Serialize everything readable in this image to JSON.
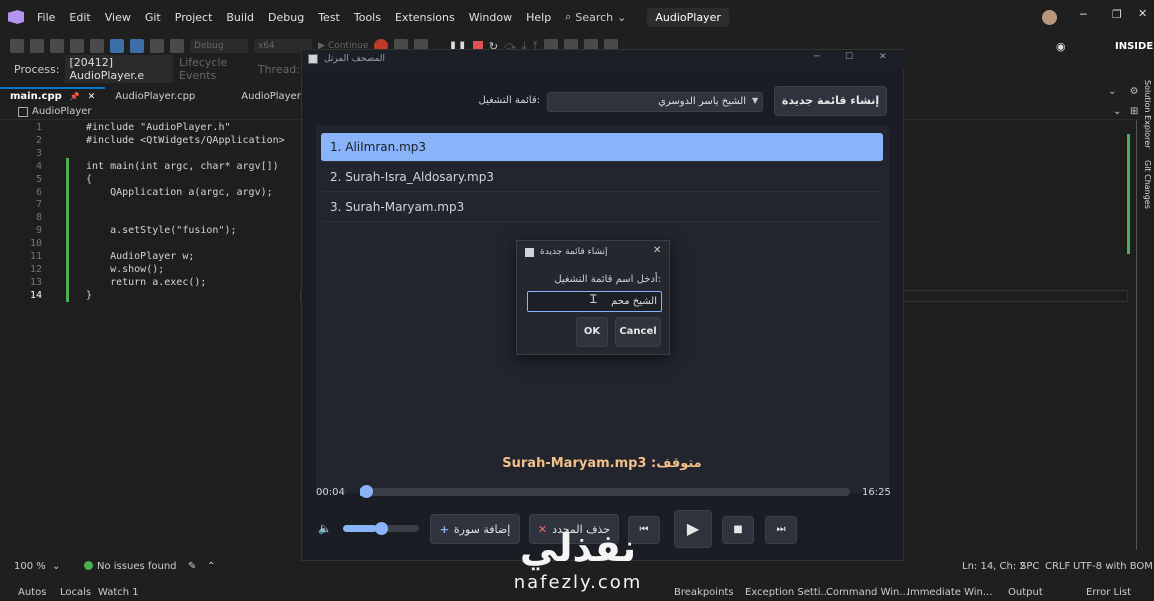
{
  "menubar": {
    "items": [
      "File",
      "Edit",
      "View",
      "Git",
      "Project",
      "Build",
      "Debug",
      "Test",
      "Tools",
      "Extensions",
      "Window",
      "Help"
    ],
    "search_label": "Search",
    "solution_name": "AudioPlayer",
    "insiders_label": "INSIDERS"
  },
  "toolbar": {
    "config": "Debug",
    "platform": "x64",
    "continue_label": "Continue"
  },
  "processbar": {
    "process_label": "Process:",
    "process_value": "[20412] AudioPlayer.e",
    "lifecycle_label": "Lifecycle Events",
    "thread_label": "Thread:"
  },
  "tabs": [
    "main.cpp",
    "AudioPlayer.cpp",
    "AudioPlayer.h"
  ],
  "nav": {
    "project": "AudioPlayer"
  },
  "side_panels": {
    "solution_explorer": "Solution Explorer",
    "git_changes": "Git Changes"
  },
  "code_lines": [
    {
      "n": "1",
      "t": "#include \"AudioPlayer.h\""
    },
    {
      "n": "2",
      "t": "#include <QtWidgets/QApplication>"
    },
    {
      "n": "3",
      "t": ""
    },
    {
      "n": "4",
      "t": "int main(int argc, char* argv[])"
    },
    {
      "n": "5",
      "t": "{"
    },
    {
      "n": "6",
      "t": "    QApplication a(argc, argv);"
    },
    {
      "n": "7",
      "t": ""
    },
    {
      "n": "8",
      "t": ""
    },
    {
      "n": "9",
      "t": "    a.setStyle(\"fusion\");"
    },
    {
      "n": "10",
      "t": ""
    },
    {
      "n": "11",
      "t": "    AudioPlayer w;"
    },
    {
      "n": "12",
      "t": "    w.show();"
    },
    {
      "n": "13",
      "t": "    return a.exec();"
    },
    {
      "n": "14",
      "t": "}"
    }
  ],
  "statusbar": {
    "zoom": "100 %",
    "issues": "No issues found",
    "position": "Ln: 14, Ch: 2",
    "spc": "SPC",
    "eol": "CRLF",
    "encoding": "UTF-8 with BOM"
  },
  "bottombar": {
    "left_tabs": [
      "Autos",
      "Locals",
      "Watch 1"
    ],
    "right_tabs": [
      "Breakpoints",
      "Exception Setti...",
      "Command Win...",
      "Immediate Win...",
      "Output",
      "Error List"
    ]
  },
  "player": {
    "window_title": "المصحف المرتل",
    "new_playlist_button": "إنشاء قائمة جديدة",
    "playlist_label": "قائمة التشغيل:",
    "playlist_selected": "الشيخ ياسر الدوسري",
    "tracks": [
      "1. AliImran.mp3",
      "2. Surah-Isra_Aldosary.mp3",
      "3. Surah-Maryam.mp3"
    ],
    "status_text": "متوقف: Surah-Maryam.mp3",
    "time_current": "00:04",
    "time_total": "16:25",
    "progress_fraction": 0.004,
    "volume_fraction": 0.45,
    "add_surah_button": "إضافة سورة",
    "delete_selected_button": "حذف المحدد",
    "accent_color": "#89b4fa"
  },
  "dialog": {
    "title": "إنشاء قائمة جديدة",
    "prompt": "أدخل اسم قائمة التشغيل:",
    "input_value": "الشيخ محم",
    "ok_label": "OK",
    "cancel_label": "Cancel"
  },
  "watermark": {
    "arabic": "نفذلي",
    "latin": "nafezly.com"
  }
}
